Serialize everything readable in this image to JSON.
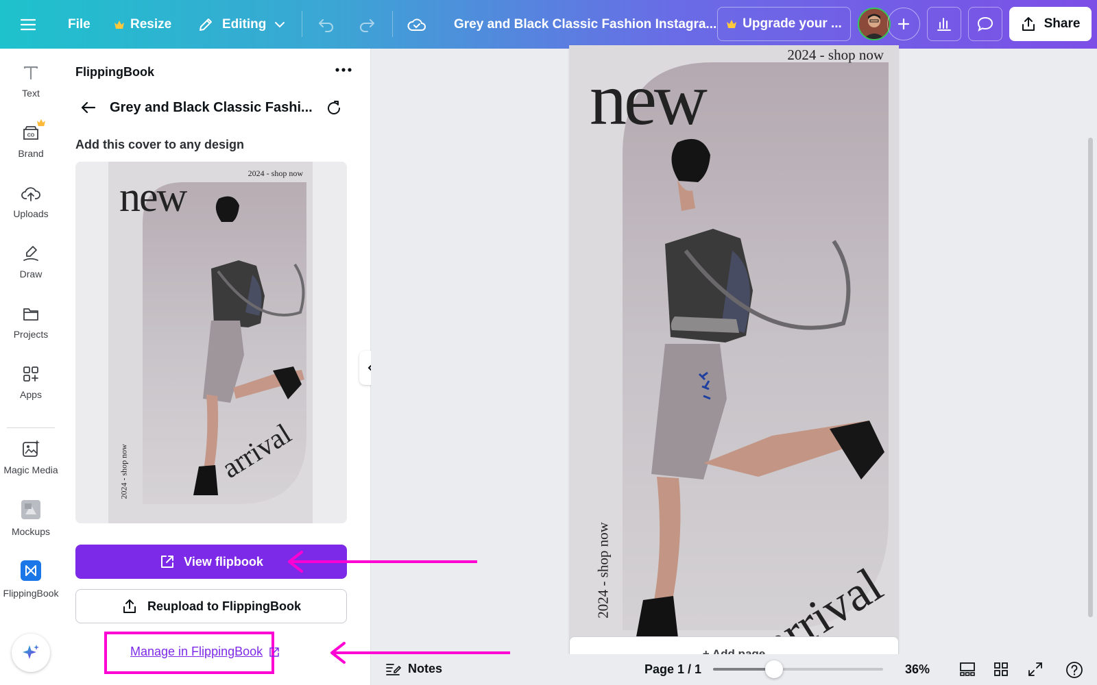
{
  "topbar": {
    "file": "File",
    "resize": "Resize",
    "mode": "Editing",
    "doc_title": "Grey and Black Classic Fashion Instagra...",
    "upgrade": "Upgrade your ...",
    "share": "Share"
  },
  "sidebar": {
    "items": [
      {
        "label": "Text",
        "icon": "text-icon"
      },
      {
        "label": "Brand",
        "icon": "brand-icon"
      },
      {
        "label": "Uploads",
        "icon": "cloud-upload-icon"
      },
      {
        "label": "Draw",
        "icon": "pen-icon"
      },
      {
        "label": "Projects",
        "icon": "folder-icon"
      },
      {
        "label": "Apps",
        "icon": "apps-icon"
      },
      {
        "label": "Magic Media",
        "icon": "magic-media-icon"
      },
      {
        "label": "Mockups",
        "icon": "mockups-icon"
      },
      {
        "label": "FlippingBook",
        "icon": "flippingbook-icon"
      }
    ]
  },
  "panel": {
    "app_name": "FlippingBook",
    "title": "Grey and Black Classic Fashi...",
    "subtitle": "Add this cover to any design",
    "view_button": "View flipbook",
    "reupload_button": "Reupload to FlippingBook",
    "manage_link": "Manage in FlippingBook"
  },
  "design": {
    "top_text": "2024 - shop now",
    "headline": "new",
    "bottom_word": "arrival",
    "side_text": "2024 - shop now",
    "add_page": "+ Add page"
  },
  "footer": {
    "notes": "Notes",
    "page": "Page 1 / 1",
    "zoom_percent": "36%",
    "zoom_level": 0.36
  },
  "colors": {
    "accent_purple": "#7d2ae8",
    "annotation_magenta": "#ff00d4",
    "brand_gradient_start": "#1ec2cc",
    "brand_gradient_end": "#7c4fe6"
  }
}
